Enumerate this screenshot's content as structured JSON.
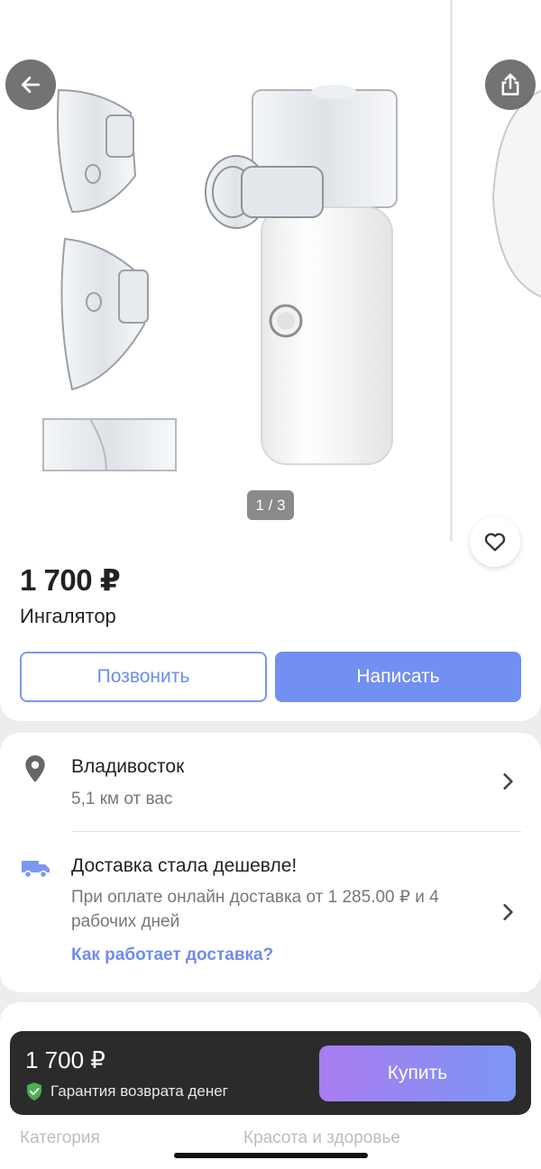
{
  "gallery": {
    "counter": "1 / 3",
    "back_icon": "arrow-left-icon",
    "share_icon": "share-icon",
    "favorite_icon": "heart-icon"
  },
  "listing": {
    "price": "1 700 ₽",
    "title": "Ингалятор"
  },
  "actions": {
    "call_label": "Позвонить",
    "write_label": "Написать"
  },
  "location": {
    "city": "Владивосток",
    "distance": "5,1 км от вас"
  },
  "delivery": {
    "title": "Доставка стала дешевле!",
    "description": "При оплате онлайн доставка от 1 285.00 ₽ и 4 рабочих дней",
    "link": "Как работает доставка?"
  },
  "details": {
    "category_label": "Категория",
    "category_value": "Красота и здоровье"
  },
  "buybar": {
    "price": "1 700 ₽",
    "guarantee": "Гарантия возврата денег",
    "buy_label": "Купить"
  },
  "colors": {
    "accent": "#728ff2",
    "buy_gradient_start": "#a97cf0",
    "buy_gradient_end": "#7c96f3",
    "guarantee_green": "#4caf50"
  }
}
